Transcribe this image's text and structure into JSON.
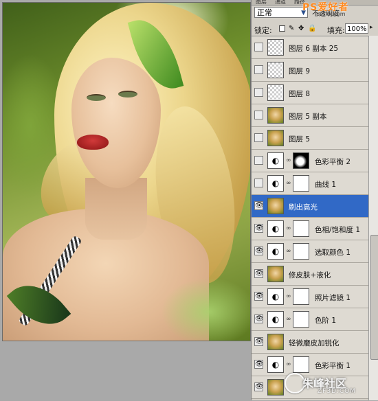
{
  "panel": {
    "tabs": [
      "图层",
      "通道",
      "路径"
    ],
    "blend_mode": "正常",
    "opacity_label": "不透明度",
    "lock_label": "锁定:",
    "fill_label": "填充:",
    "fill_value": "100%"
  },
  "layers": [
    {
      "name": "图层 6 副本 25",
      "visible": false,
      "thumb": "transparent",
      "mask": false,
      "selected": false
    },
    {
      "name": "图层 9",
      "visible": false,
      "thumb": "transparent",
      "mask": false,
      "selected": false
    },
    {
      "name": "图层 8",
      "visible": false,
      "thumb": "transparent",
      "mask": false,
      "selected": false
    },
    {
      "name": "图层 5 副本",
      "visible": false,
      "thumb": "photo",
      "mask": false,
      "selected": false
    },
    {
      "name": "图层 5",
      "visible": false,
      "thumb": "photo",
      "mask": false,
      "selected": false
    },
    {
      "name": "色彩平衡 2",
      "visible": false,
      "thumb": "adjustment",
      "mask": "dark",
      "selected": false
    },
    {
      "name": "曲线 1",
      "visible": false,
      "thumb": "adjustment",
      "mask": "white",
      "selected": false
    },
    {
      "name": "刷出高光",
      "visible": true,
      "thumb": "photo",
      "mask": false,
      "selected": true
    },
    {
      "name": "色相/饱和度 1",
      "visible": true,
      "thumb": "adjustment",
      "mask": "white",
      "selected": false
    },
    {
      "name": "选取颜色 1",
      "visible": true,
      "thumb": "adjustment",
      "mask": "white",
      "selected": false
    },
    {
      "name": "修皮肤+液化",
      "visible": true,
      "thumb": "photo",
      "mask": false,
      "selected": false
    },
    {
      "name": "照片滤镜 1",
      "visible": true,
      "thumb": "adjustment",
      "mask": "white",
      "selected": false
    },
    {
      "name": "色阶 1",
      "visible": true,
      "thumb": "adjustment",
      "mask": "white",
      "selected": false
    },
    {
      "name": "轻微磨皮加锐化",
      "visible": true,
      "thumb": "photo",
      "mask": false,
      "selected": false
    },
    {
      "name": "色彩平衡 1",
      "visible": true,
      "thumb": "adjustment",
      "mask": "white",
      "selected": false
    },
    {
      "name": "",
      "visible": true,
      "thumb": "photo",
      "mask": false,
      "selected": false
    }
  ],
  "watermark": {
    "top_text": "PS爱好者",
    "top_sub": "pssxx.com",
    "bottom_text": "朱峰社区",
    "bottom_sub": "ZF3D.COM"
  },
  "colors": {
    "selection": "#3169c6",
    "panel_bg": "#d4d0c8"
  }
}
